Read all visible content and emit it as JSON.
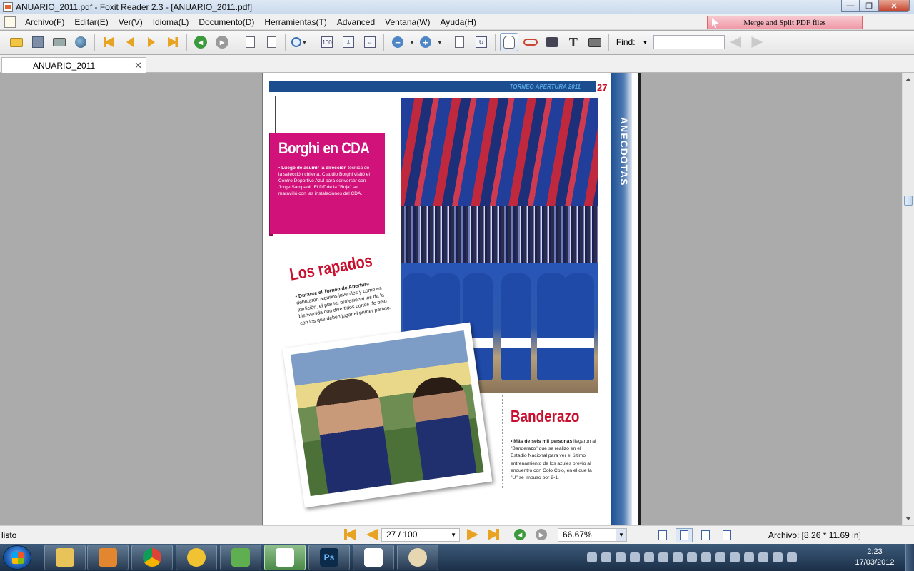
{
  "window": {
    "title": "ANUARIO_2011.pdf - Foxit Reader 2.3 - [ANUARIO_2011.pdf]",
    "minimize": "—",
    "maximize": "❐",
    "close": "✕"
  },
  "menu": {
    "items": [
      "Archivo(F)",
      "Editar(E)",
      "Ver(V)",
      "Idioma(L)",
      "Documento(D)",
      "Herramientas(T)",
      "Advanced",
      "Ventana(W)",
      "Ayuda(H)"
    ]
  },
  "ad": {
    "label": "Merge and Split PDF files"
  },
  "toolbar": {
    "find_label": "Find:",
    "find_value": "",
    "fit_page_label": "100\n%",
    "icons": [
      "open-icon",
      "save-icon",
      "print-icon",
      "email-icon",
      "first-page-icon",
      "previous-page-icon",
      "next-page-icon",
      "last-page-icon",
      "back-icon",
      "forward-icon",
      "rotate-left-icon",
      "rotate-right-icon",
      "zoom-tool-icon",
      "actual-size-icon",
      "fit-page-icon",
      "fit-width-icon",
      "zoom-out-icon",
      "zoom-in-icon",
      "bookmark-icon",
      "rotate-view-icon",
      "hand-tool-icon",
      "typewriter-icon",
      "find-icon",
      "text-select-icon",
      "snapshot-icon",
      "find-previous-icon",
      "find-next-icon"
    ]
  },
  "tabs": [
    {
      "label": "ANUARIO_2011",
      "close": "✕"
    }
  ],
  "page": {
    "header": "TORNEO APERTURA 2011",
    "number": "27",
    "side_label": "ANECDOTAS",
    "borghi": {
      "title": "Borghi en CDA",
      "lead": "• Luego de asumir la dirección",
      "body": "técnica de la selección chilena, Claudio Borghi visitó el Centro Deportivo Azul para conversar con Jorge Sampaoli. El DT de la \"Roja\" se maravilló con las instalaciones del CDA."
    },
    "rapados": {
      "title": "Los rapados",
      "lead": "• Durante el Torneo de Apertura",
      "body": "debutaron algunos juveniles y como es tradición, el plantel profesional les da la bienvenida con divertidos cortes de pelo con los que deben jugar el primer partido."
    },
    "banderazo": {
      "title": "Banderazo",
      "lead": "• Más de seis mil personas",
      "body": "llegaron al \"Banderazo\" que se realizó en el Estadio Nacional para ver el último entrenamiento de los azules previo al encuentro con Colo Colo, en el que la \"U\" se impuso por 2-1."
    }
  },
  "status": {
    "text": "listo",
    "page_value": "27 / 100",
    "zoom_value": "66.67%",
    "size_text": "Archivo: [8.26 * 11.69 in]"
  },
  "taskbar": {
    "time": "2:23",
    "date": "17/03/2012",
    "apps": [
      "explorer-icon",
      "media-player-icon",
      "chrome-icon",
      "app-a-icon",
      "messenger-icon",
      "foxit-reader-icon",
      "photoshop-icon",
      "app-pen-icon",
      "paint-icon"
    ],
    "photoshop_label": "Ps"
  },
  "colors": {
    "accent_blue": "#1c4d8f",
    "magenta": "#d1127a",
    "red_title": "#c8102e"
  }
}
